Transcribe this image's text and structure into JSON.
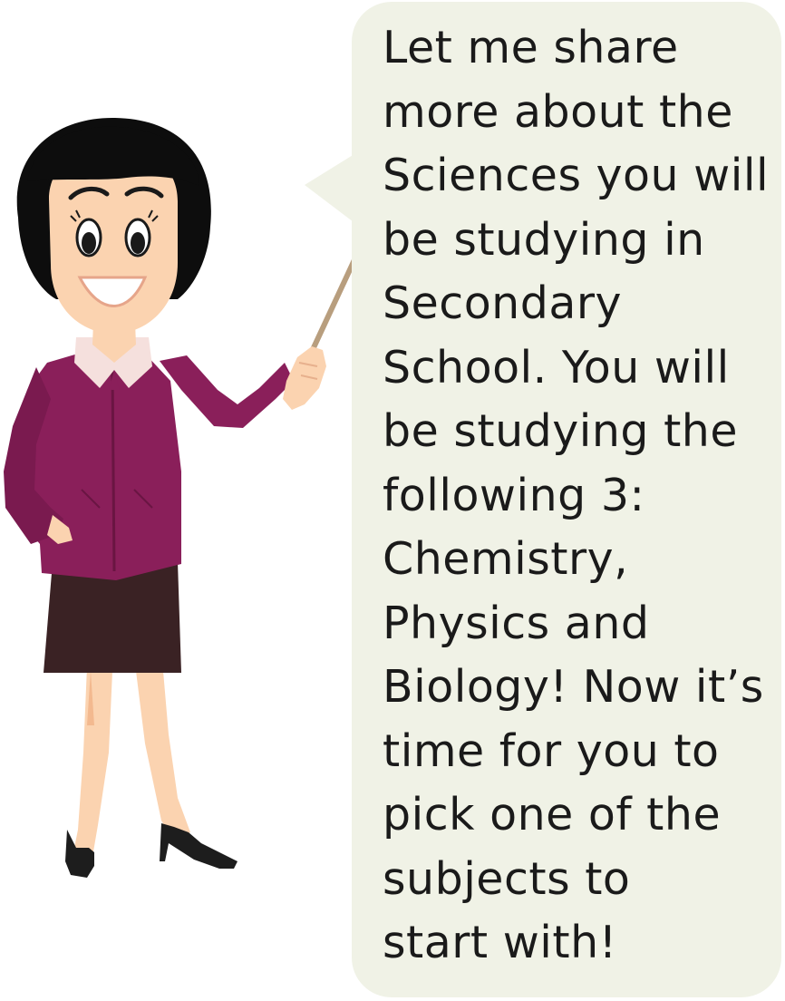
{
  "speech_bubble": {
    "text": "Let me share\nmore about the\nSciences you will\nbe studying in\nSecondary\nSchool. You will\nbe studying the\nfollowing 3:\nChemistry,\nPhysics and\nBiology! Now it’s\ntime for you to\npick one of the\nsubjects to\nstart with!",
    "background_color": "#f0f2e6"
  },
  "teacher": {
    "icon": "teacher-with-pointer-illustration",
    "cardigan_color": "#8a1f5a",
    "skirt_color": "#3a2224",
    "hair_color": "#0d0d0d",
    "skin_color": "#fbd3b0"
  }
}
